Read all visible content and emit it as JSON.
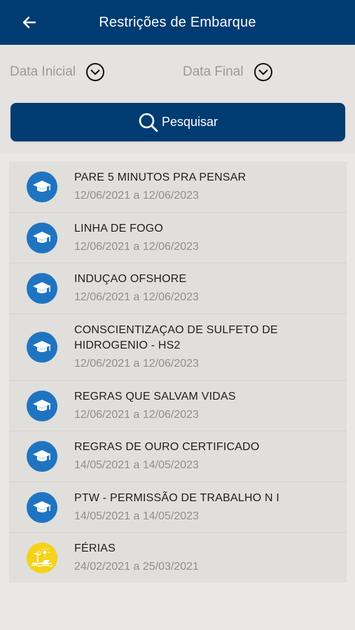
{
  "header": {
    "title": "Restrições de Embarque"
  },
  "filters": {
    "start_label": "Data Inicial",
    "end_label": "Data Final",
    "search_label": "Pesquisar"
  },
  "colors": {
    "primary": "#003c72",
    "icon_blue": "#1f74c2",
    "icon_yellow": "#f5d21b"
  },
  "items": [
    {
      "title": "PARE 5 MINUTOS PRA PENSAR",
      "dates": "12/06/2021 a 12/06/2023",
      "icon": "graduation-cap-icon"
    },
    {
      "title": "LINHA DE FOGO",
      "dates": "12/06/2021 a 12/06/2023",
      "icon": "graduation-cap-icon"
    },
    {
      "title": "INDUÇAO OFSHORE",
      "dates": "12/06/2021 a 12/06/2023",
      "icon": "graduation-cap-icon"
    },
    {
      "title": "CONSCIENTIZAÇAO DE SULFETO DE HIDROGENIO - HS2",
      "dates": "12/06/2021 a 12/06/2023",
      "icon": "graduation-cap-icon"
    },
    {
      "title": "REGRAS QUE SALVAM VIDAS",
      "dates": "12/06/2021 a 12/06/2023",
      "icon": "graduation-cap-icon"
    },
    {
      "title": "REGRAS DE OURO CERTIFICADO",
      "dates": "14/05/2021 a 14/05/2023",
      "icon": "graduation-cap-icon"
    },
    {
      "title": "PTW - PERMISSÃO DE TRABALHO N I",
      "dates": "14/05/2021 a 14/05/2023",
      "icon": "graduation-cap-icon"
    },
    {
      "title": "FÉRIAS",
      "dates": "24/02/2021 a 25/03/2021",
      "icon": "beach-vacation-icon"
    }
  ]
}
